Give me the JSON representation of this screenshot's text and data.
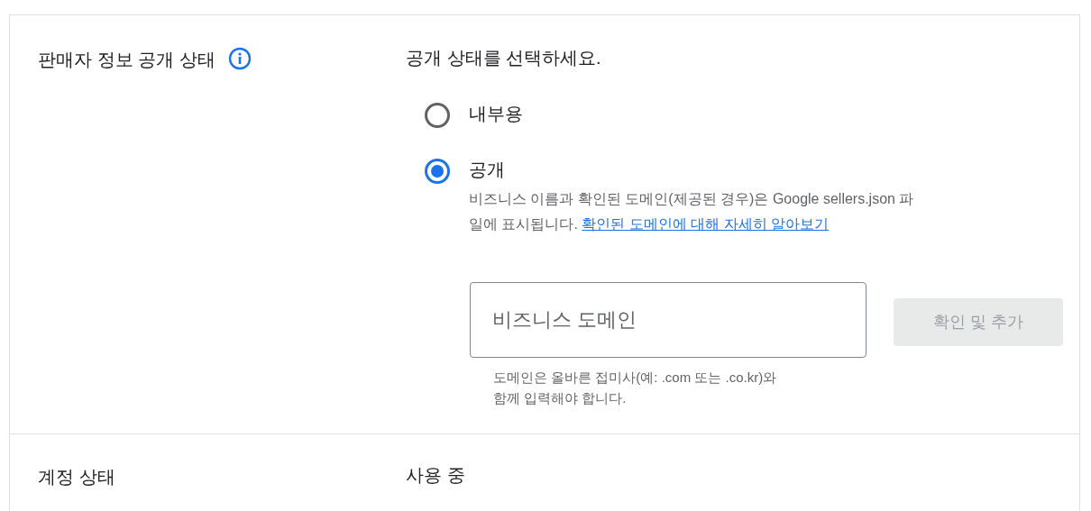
{
  "sections": [
    {
      "label": "판매자 정보 공개 상태",
      "info_icon": true,
      "prompt": "공개 상태를 선택하세요.",
      "options": [
        {
          "label": "내부용",
          "selected": false
        },
        {
          "label": "공개",
          "selected": true,
          "description": "비즈니스 이름과 확인된 도메인(제공된 경우)은 Google sellers.json 파일에 표시됩니다.",
          "link": "확인된 도메인에 대해 자세히 알아보기"
        }
      ],
      "domain_field": {
        "placeholder": "비즈니스 도메인",
        "helper": "도메인은 올바른 접미사(예: .com 또는 .co.kr)와 함께 입력해야 합니다."
      },
      "add_button": {
        "label": "확인 및 추가",
        "disabled": true
      }
    },
    {
      "label": "계정 상태",
      "value": "사용 중"
    }
  ]
}
